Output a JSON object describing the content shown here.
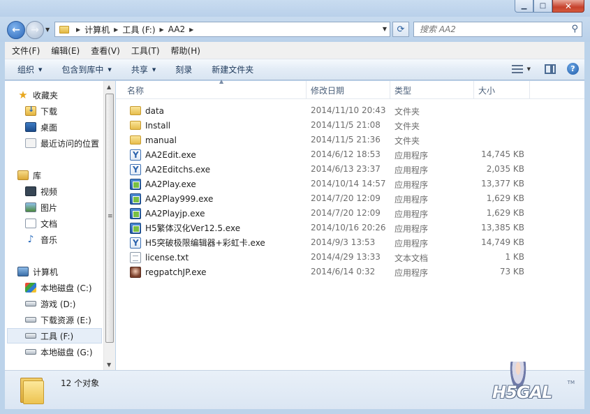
{
  "window": {
    "minimize_glyph": "▁",
    "maximize_glyph": "□",
    "close_glyph": "✕"
  },
  "nav": {
    "back_glyph": "←",
    "forward_glyph": "→",
    "breadcrumbs": [
      "计算机",
      "工具 (F:)",
      "AA2"
    ],
    "search_placeholder": "搜索 AA2"
  },
  "menubar": [
    "文件(F)",
    "编辑(E)",
    "查看(V)",
    "工具(T)",
    "帮助(H)"
  ],
  "commandbar": {
    "organize": "组织",
    "include_in_library": "包含到库中",
    "share": "共享",
    "burn": "刻录",
    "new_folder": "新建文件夹"
  },
  "sidebar": {
    "favorites": {
      "label": "收藏夹",
      "items": [
        "下载",
        "桌面",
        "最近访问的位置"
      ]
    },
    "libraries": {
      "label": "库",
      "items": [
        "视频",
        "图片",
        "文档",
        "音乐"
      ]
    },
    "computer": {
      "label": "计算机",
      "items": [
        "本地磁盘 (C:)",
        "游戏 (D:)",
        "下载资源 (E:)",
        "工具 (F:)",
        "本地磁盘 (G:)"
      ]
    }
  },
  "columns": {
    "name": "名称",
    "date": "修改日期",
    "type": "类型",
    "size": "大小"
  },
  "files": [
    {
      "name": "data",
      "date": "2014/11/10 20:43",
      "type": "文件夹",
      "size": "",
      "icon": "folder-icon"
    },
    {
      "name": "Install",
      "date": "2014/11/5 21:08",
      "type": "文件夹",
      "size": "",
      "icon": "folder-icon"
    },
    {
      "name": "manual",
      "date": "2014/11/5 21:36",
      "type": "文件夹",
      "size": "",
      "icon": "folder-icon"
    },
    {
      "name": "AA2Edit.exe",
      "date": "2014/6/12 18:53",
      "type": "应用程序",
      "size": "14,745 KB",
      "icon": "exe-edit-icon"
    },
    {
      "name": "AA2Editchs.exe",
      "date": "2014/6/13 23:37",
      "type": "应用程序",
      "size": "2,035 KB",
      "icon": "exe-edit-icon"
    },
    {
      "name": "AA2Play.exe",
      "date": "2014/10/14 14:57",
      "type": "应用程序",
      "size": "13,377 KB",
      "icon": "exe-play-icon"
    },
    {
      "name": "AA2Play999.exe",
      "date": "2014/7/20 12:09",
      "type": "应用程序",
      "size": "1,629 KB",
      "icon": "exe-play-icon"
    },
    {
      "name": "AA2Playjp.exe",
      "date": "2014/7/20 12:09",
      "type": "应用程序",
      "size": "1,629 KB",
      "icon": "exe-play-icon"
    },
    {
      "name": "H5繁体汉化Ver12.5.exe",
      "date": "2014/10/16 20:26",
      "type": "应用程序",
      "size": "13,385 KB",
      "icon": "exe-play-icon"
    },
    {
      "name": "H5突破极限编辑器+彩虹卡.exe",
      "date": "2014/9/3 13:53",
      "type": "应用程序",
      "size": "14,749 KB",
      "icon": "exe-edit-icon"
    },
    {
      "name": "license.txt",
      "date": "2014/4/29 13:33",
      "type": "文本文档",
      "size": "1 KB",
      "icon": "txt-icon"
    },
    {
      "name": "regpatchJP.exe",
      "date": "2014/6/14 0:32",
      "type": "应用程序",
      "size": "73 KB",
      "icon": "patch-icon"
    }
  ],
  "details": {
    "count": "12 个对象"
  },
  "watermark": {
    "text": "H5GAL",
    "mark": "TM"
  }
}
